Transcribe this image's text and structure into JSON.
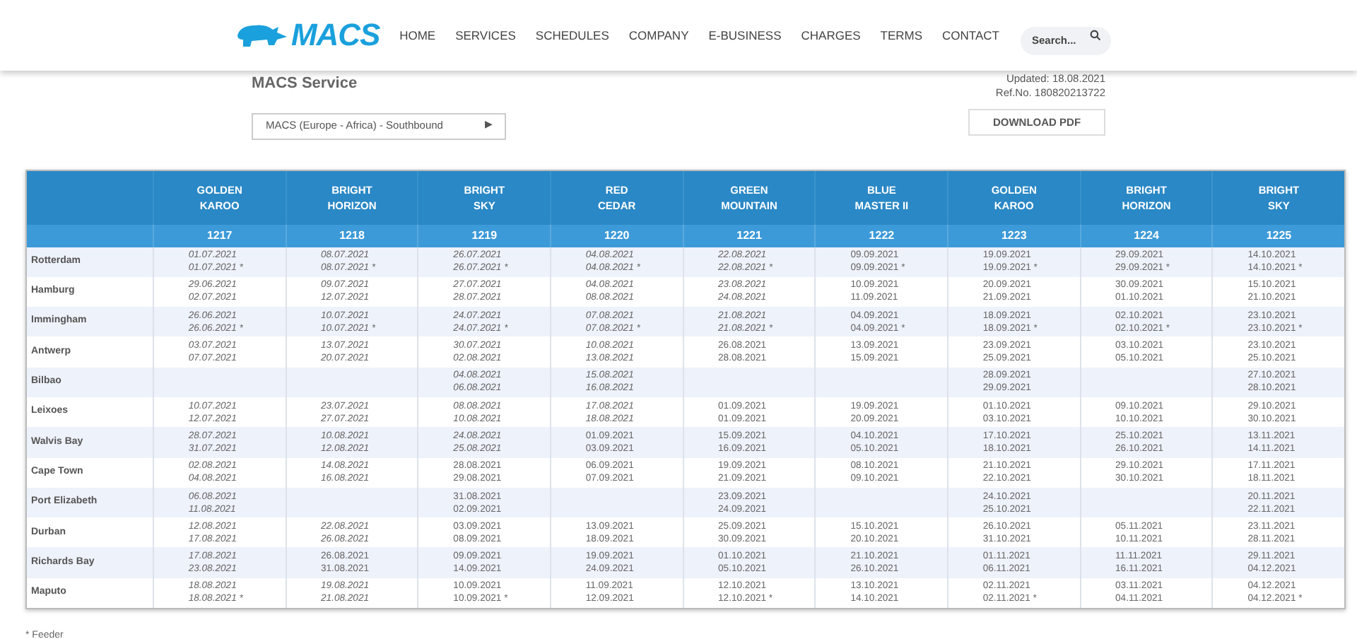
{
  "nav": {
    "logo_text": "MACS",
    "items": [
      "HOME",
      "SERVICES",
      "SCHEDULES",
      "COMPANY",
      "E-BUSINESS",
      "CHARGES",
      "TERMS",
      "CONTACT"
    ],
    "search": {
      "placeholder": "Search..."
    }
  },
  "page": {
    "title": "MACS Service",
    "updated": "Updated: 18.08.2021",
    "ref": "Ref.No. 180820213722",
    "service_select": "MACS (Europe - Africa) - Southbound",
    "select_arrow": "▶",
    "download_button": "DOWNLOAD PDF"
  },
  "table": {
    "vessels": [
      {
        "name": "GOLDEN KAROO",
        "voyage": "1217"
      },
      {
        "name": "BRIGHT HORIZON",
        "voyage": "1218"
      },
      {
        "name": "BRIGHT SKY",
        "voyage": "1219"
      },
      {
        "name": "RED CEDAR",
        "voyage": "1220"
      },
      {
        "name": "GREEN MOUNTAIN",
        "voyage": "1221"
      },
      {
        "name": "BLUE MASTER II",
        "voyage": "1222"
      },
      {
        "name": "GOLDEN KAROO",
        "voyage": "1223"
      },
      {
        "name": "BRIGHT HORIZON",
        "voyage": "1224"
      },
      {
        "name": "BRIGHT SKY",
        "voyage": "1225"
      }
    ],
    "rows": [
      {
        "port": "Rotterdam",
        "cells": [
          {
            "lines": [
              "01.07.2021",
              "01.07.2021 *"
            ],
            "italic": true
          },
          {
            "lines": [
              "08.07.2021",
              "08.07.2021 *"
            ],
            "italic": true
          },
          {
            "lines": [
              "26.07.2021",
              "26.07.2021 *"
            ],
            "italic": true
          },
          {
            "lines": [
              "04.08.2021",
              "04.08.2021 *"
            ],
            "italic": true
          },
          {
            "lines": [
              "22.08.2021",
              "22.08.2021 *"
            ],
            "italic": true
          },
          {
            "lines": [
              "09.09.2021",
              "09.09.2021 *"
            ],
            "italic": false
          },
          {
            "lines": [
              "19.09.2021",
              "19.09.2021 *"
            ],
            "italic": false
          },
          {
            "lines": [
              "29.09.2021",
              "29.09.2021 *"
            ],
            "italic": false
          },
          {
            "lines": [
              "14.10.2021",
              "14.10.2021 *"
            ],
            "italic": false
          }
        ]
      },
      {
        "port": "Hamburg",
        "cells": [
          {
            "lines": [
              "29.06.2021",
              "02.07.2021"
            ],
            "italic": true
          },
          {
            "lines": [
              "09.07.2021",
              "12.07.2021"
            ],
            "italic": true
          },
          {
            "lines": [
              "27.07.2021",
              "28.07.2021"
            ],
            "italic": true
          },
          {
            "lines": [
              "04.08.2021",
              "08.08.2021"
            ],
            "italic": true
          },
          {
            "lines": [
              "23.08.2021",
              "24.08.2021"
            ],
            "italic": true
          },
          {
            "lines": [
              "10.09.2021",
              "11.09.2021"
            ],
            "italic": false
          },
          {
            "lines": [
              "20.09.2021",
              "21.09.2021"
            ],
            "italic": false
          },
          {
            "lines": [
              "30.09.2021",
              "01.10.2021"
            ],
            "italic": false
          },
          {
            "lines": [
              "15.10.2021",
              "21.10.2021"
            ],
            "italic": false
          }
        ]
      },
      {
        "port": "Immingham",
        "cells": [
          {
            "lines": [
              "26.06.2021",
              "26.06.2021 *"
            ],
            "italic": true
          },
          {
            "lines": [
              "10.07.2021",
              "10.07.2021 *"
            ],
            "italic": true
          },
          {
            "lines": [
              "24.07.2021",
              "24.07.2021 *"
            ],
            "italic": true
          },
          {
            "lines": [
              "07.08.2021",
              "07.08.2021 *"
            ],
            "italic": true
          },
          {
            "lines": [
              "21.08.2021",
              "21.08.2021 *"
            ],
            "italic": true
          },
          {
            "lines": [
              "04.09.2021",
              "04.09.2021 *"
            ],
            "italic": false
          },
          {
            "lines": [
              "18.09.2021",
              "18.09.2021 *"
            ],
            "italic": false
          },
          {
            "lines": [
              "02.10.2021",
              "02.10.2021 *"
            ],
            "italic": false
          },
          {
            "lines": [
              "23.10.2021",
              "23.10.2021 *"
            ],
            "italic": false
          }
        ]
      },
      {
        "port": "Antwerp",
        "cells": [
          {
            "lines": [
              "03.07.2021",
              "07.07.2021"
            ],
            "italic": true
          },
          {
            "lines": [
              "13.07.2021",
              "20.07.2021"
            ],
            "italic": true
          },
          {
            "lines": [
              "30.07.2021",
              "02.08.2021"
            ],
            "italic": true
          },
          {
            "lines": [
              "10.08.2021",
              "13.08.2021"
            ],
            "italic": true
          },
          {
            "lines": [
              "26.08.2021",
              "28.08.2021"
            ],
            "italic": false
          },
          {
            "lines": [
              "13.09.2021",
              "15.09.2021"
            ],
            "italic": false
          },
          {
            "lines": [
              "23.09.2021",
              "25.09.2021"
            ],
            "italic": false
          },
          {
            "lines": [
              "03.10.2021",
              "05.10.2021"
            ],
            "italic": false
          },
          {
            "lines": [
              "23.10.2021",
              "25.10.2021"
            ],
            "italic": false
          }
        ]
      },
      {
        "port": "Bilbao",
        "cells": [
          null,
          null,
          {
            "lines": [
              "04.08.2021",
              "06.08.2021"
            ],
            "italic": true
          },
          {
            "lines": [
              "15.08.2021",
              "16.08.2021"
            ],
            "italic": true
          },
          null,
          null,
          {
            "lines": [
              "28.09.2021",
              "29.09.2021"
            ],
            "italic": false
          },
          null,
          {
            "lines": [
              "27.10.2021",
              "28.10.2021"
            ],
            "italic": false
          }
        ]
      },
      {
        "port": "Leixoes",
        "cells": [
          {
            "lines": [
              "10.07.2021",
              "12.07.2021"
            ],
            "italic": true
          },
          {
            "lines": [
              "23.07.2021",
              "27.07.2021"
            ],
            "italic": true
          },
          {
            "lines": [
              "08.08.2021",
              "10.08.2021"
            ],
            "italic": true
          },
          {
            "lines": [
              "17.08.2021",
              "18.08.2021"
            ],
            "italic": true
          },
          {
            "lines": [
              "01.09.2021",
              "01.09.2021"
            ],
            "italic": false
          },
          {
            "lines": [
              "19.09.2021",
              "20.09.2021"
            ],
            "italic": false
          },
          {
            "lines": [
              "01.10.2021",
              "03.10.2021"
            ],
            "italic": false
          },
          {
            "lines": [
              "09.10.2021",
              "10.10.2021"
            ],
            "italic": false
          },
          {
            "lines": [
              "29.10.2021",
              "30.10.2021"
            ],
            "italic": false
          }
        ]
      },
      {
        "port": "Walvis Bay",
        "cells": [
          {
            "lines": [
              "28.07.2021",
              "31.07.2021"
            ],
            "italic": true
          },
          {
            "lines": [
              "10.08.2021",
              "12.08.2021"
            ],
            "italic": true
          },
          {
            "lines": [
              "24.08.2021",
              "25.08.2021"
            ],
            "italic": true
          },
          {
            "lines": [
              "01.09.2021",
              "03.09.2021"
            ],
            "italic": false
          },
          {
            "lines": [
              "15.09.2021",
              "16.09.2021"
            ],
            "italic": false
          },
          {
            "lines": [
              "04.10.2021",
              "05.10.2021"
            ],
            "italic": false
          },
          {
            "lines": [
              "17.10.2021",
              "18.10.2021"
            ],
            "italic": false
          },
          {
            "lines": [
              "25.10.2021",
              "26.10.2021"
            ],
            "italic": false
          },
          {
            "lines": [
              "13.11.2021",
              "14.11.2021"
            ],
            "italic": false
          }
        ]
      },
      {
        "port": "Cape Town",
        "cells": [
          {
            "lines": [
              "02.08.2021",
              "04.08.2021"
            ],
            "italic": true
          },
          {
            "lines": [
              "14.08.2021",
              "16.08.2021"
            ],
            "italic": true
          },
          {
            "lines": [
              "28.08.2021",
              "29.08.2021"
            ],
            "italic": false
          },
          {
            "lines": [
              "06.09.2021",
              "07.09.2021"
            ],
            "italic": false
          },
          {
            "lines": [
              "19.09.2021",
              "21.09.2021"
            ],
            "italic": false
          },
          {
            "lines": [
              "08.10.2021",
              "09.10.2021"
            ],
            "italic": false
          },
          {
            "lines": [
              "21.10.2021",
              "22.10.2021"
            ],
            "italic": false
          },
          {
            "lines": [
              "29.10.2021",
              "30.10.2021"
            ],
            "italic": false
          },
          {
            "lines": [
              "17.11.2021",
              "18.11.2021"
            ],
            "italic": false
          }
        ]
      },
      {
        "port": "Port Elizabeth",
        "cells": [
          {
            "lines": [
              "06.08.2021",
              "11.08.2021"
            ],
            "italic": true
          },
          null,
          {
            "lines": [
              "31.08.2021",
              "02.09.2021"
            ],
            "italic": false
          },
          null,
          {
            "lines": [
              "23.09.2021",
              "24.09.2021"
            ],
            "italic": false
          },
          null,
          {
            "lines": [
              "24.10.2021",
              "25.10.2021"
            ],
            "italic": false
          },
          null,
          {
            "lines": [
              "20.11.2021",
              "22.11.2021"
            ],
            "italic": false
          }
        ]
      },
      {
        "port": "Durban",
        "cells": [
          {
            "lines": [
              "12.08.2021",
              "17.08.2021"
            ],
            "italic": true
          },
          {
            "lines": [
              "22.08.2021",
              "26.08.2021"
            ],
            "italic": true
          },
          {
            "lines": [
              "03.09.2021",
              "08.09.2021"
            ],
            "italic": false
          },
          {
            "lines": [
              "13.09.2021",
              "18.09.2021"
            ],
            "italic": false
          },
          {
            "lines": [
              "25.09.2021",
              "30.09.2021"
            ],
            "italic": false
          },
          {
            "lines": [
              "15.10.2021",
              "20.10.2021"
            ],
            "italic": false
          },
          {
            "lines": [
              "26.10.2021",
              "31.10.2021"
            ],
            "italic": false
          },
          {
            "lines": [
              "05.11.2021",
              "10.11.2021"
            ],
            "italic": false
          },
          {
            "lines": [
              "23.11.2021",
              "28.11.2021"
            ],
            "italic": false
          }
        ]
      },
      {
        "port": "Richards Bay",
        "cells": [
          {
            "lines": [
              "17.08.2021",
              "23.08.2021"
            ],
            "italic": true
          },
          {
            "lines": [
              "26.08.2021",
              "31.08.2021"
            ],
            "italic": false
          },
          {
            "lines": [
              "09.09.2021",
              "14.09.2021"
            ],
            "italic": false
          },
          {
            "lines": [
              "19.09.2021",
              "24.09.2021"
            ],
            "italic": false
          },
          {
            "lines": [
              "01.10.2021",
              "05.10.2021"
            ],
            "italic": false
          },
          {
            "lines": [
              "21.10.2021",
              "26.10.2021"
            ],
            "italic": false
          },
          {
            "lines": [
              "01.11.2021",
              "06.11.2021"
            ],
            "italic": false
          },
          {
            "lines": [
              "11.11.2021",
              "16.11.2021"
            ],
            "italic": false
          },
          {
            "lines": [
              "29.11.2021",
              "04.12.2021"
            ],
            "italic": false
          }
        ]
      },
      {
        "port": "Maputo",
        "cells": [
          {
            "lines": [
              "18.08.2021",
              "18.08.2021 *"
            ],
            "italic": true
          },
          {
            "lines": [
              "19.08.2021",
              "21.08.2021"
            ],
            "italic": true
          },
          {
            "lines": [
              "10.09.2021",
              "10.09.2021 *"
            ],
            "italic": false
          },
          {
            "lines": [
              "11.09.2021",
              "12.09.2021"
            ],
            "italic": false
          },
          {
            "lines": [
              "12.10.2021",
              "12.10.2021 *"
            ],
            "italic": false
          },
          {
            "lines": [
              "13.10.2021",
              "14.10.2021"
            ],
            "italic": false
          },
          {
            "lines": [
              "02.11.2021",
              "02.11.2021 *"
            ],
            "italic": false
          },
          {
            "lines": [
              "03.11.2021",
              "04.11.2021"
            ],
            "italic": false
          },
          {
            "lines": [
              "04.12.2021",
              "04.12.2021 *"
            ],
            "italic": false
          }
        ]
      }
    ]
  },
  "footnote": "* Feeder"
}
